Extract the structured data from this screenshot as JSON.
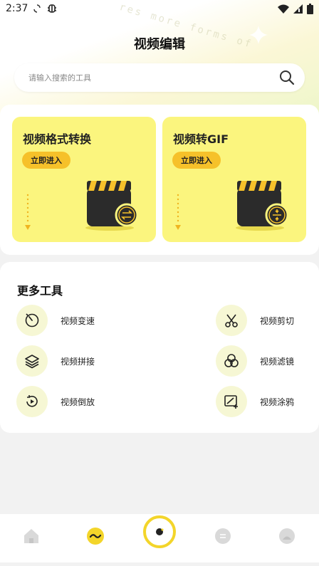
{
  "status_bar": {
    "time": "2:37",
    "icons": [
      "sync-icon",
      "bug-icon",
      "wifi-icon",
      "signal-icon",
      "battery-icon"
    ]
  },
  "header": {
    "title": "视频编辑",
    "decoration_text": "res more forms of"
  },
  "search": {
    "placeholder": "请输入搜索的工具",
    "icon": "search-icon"
  },
  "feature_cards": [
    {
      "title": "视频格式转换",
      "button_label": "立即进入",
      "icon": "clapperboard-convert-icon"
    },
    {
      "title": "视频转GIF",
      "button_label": "立即进入",
      "icon": "clapperboard-gif-icon"
    }
  ],
  "more_tools": {
    "title": "更多工具",
    "items": [
      {
        "label": "视频变速",
        "icon": "speed-icon"
      },
      {
        "label": "视频剪切",
        "icon": "scissors-icon"
      },
      {
        "label": "视频拼接",
        "icon": "layers-icon"
      },
      {
        "label": "视频滤镜",
        "icon": "filter-icon"
      },
      {
        "label": "视频倒放",
        "icon": "reverse-play-icon"
      },
      {
        "label": "视频涂鸦",
        "icon": "doodle-icon"
      }
    ]
  },
  "tab_bar": {
    "items": [
      {
        "icon": "home-icon",
        "active": false
      },
      {
        "icon": "wave-icon",
        "active": true
      },
      {
        "icon": "camera-icon",
        "active": false
      },
      {
        "icon": "chat-icon",
        "active": false
      },
      {
        "icon": "profile-icon",
        "active": false
      }
    ]
  },
  "colors": {
    "card_bg": "#fbf57e",
    "button_bg": "#f6c12a",
    "accent_yellow": "#f3d52a",
    "tool_icon_bg": "#f6f7d4"
  }
}
